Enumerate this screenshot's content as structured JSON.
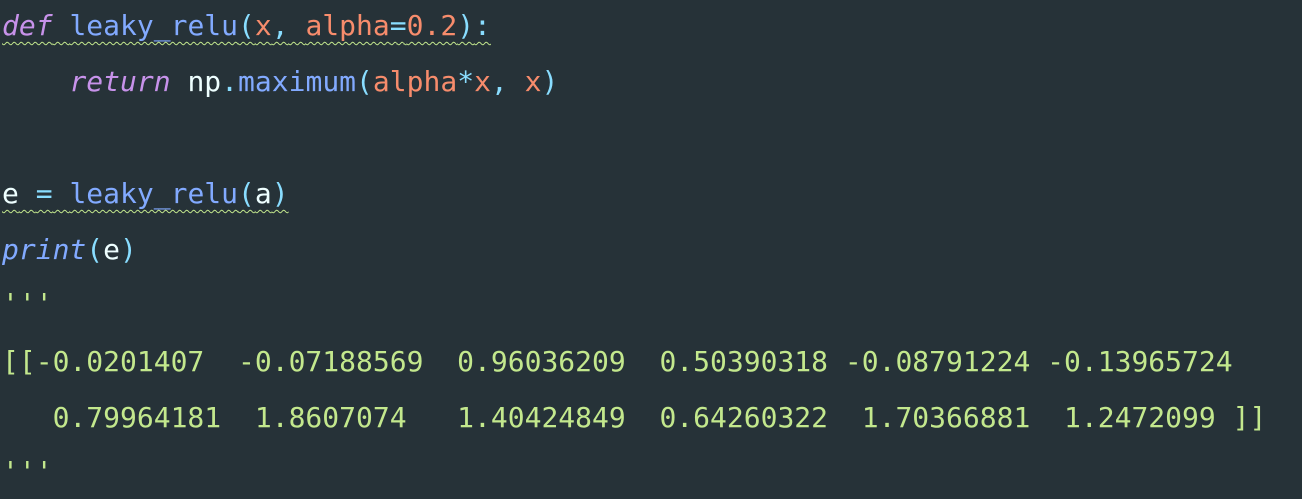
{
  "editor": {
    "line1": {
      "kw_def": "def",
      "fn_name": "leaky_relu",
      "open_paren": "(",
      "param_x": "x",
      "comma": ",",
      "param_alpha": "alpha",
      "eq": "=",
      "num_default": "0.2",
      "close_paren": ")",
      "colon": ":"
    },
    "line2": {
      "indent": "    ",
      "kw_return": "return",
      "np": "np",
      "dot": ".",
      "fn_maximum": "maximum",
      "open_paren": "(",
      "arg_alpha": "alpha",
      "op_mul": "*",
      "arg_x1": "x",
      "comma": ",",
      "arg_x2": "x",
      "close_paren": ")"
    },
    "line3": {
      "var_e": "e",
      "eq": "=",
      "fn_call": "leaky_relu",
      "open_paren": "(",
      "arg_a": "a",
      "close_paren": ")"
    },
    "line4": {
      "fn_print": "print",
      "open_paren": "(",
      "arg_e": "e",
      "close_paren": ")"
    },
    "line5": {
      "docstring_open": "'''"
    },
    "line6": {
      "output_row1": "[[-0.0201407  -0.07188569  0.96036209  0.50390318 -0.08791224 -0.13965724"
    },
    "line7": {
      "output_row2": "   0.79964181  1.8607074   1.40424849  0.64260322  1.70366881  1.2472099 ]]"
    },
    "line8": {
      "docstring_close": "'''"
    }
  },
  "colors": {
    "background": "#263238",
    "keyword": "#c792ea",
    "function": "#82aaff",
    "number_param": "#f78c6c",
    "operator": "#89ddff",
    "string": "#c3e88d",
    "plain": "#eeffff"
  }
}
